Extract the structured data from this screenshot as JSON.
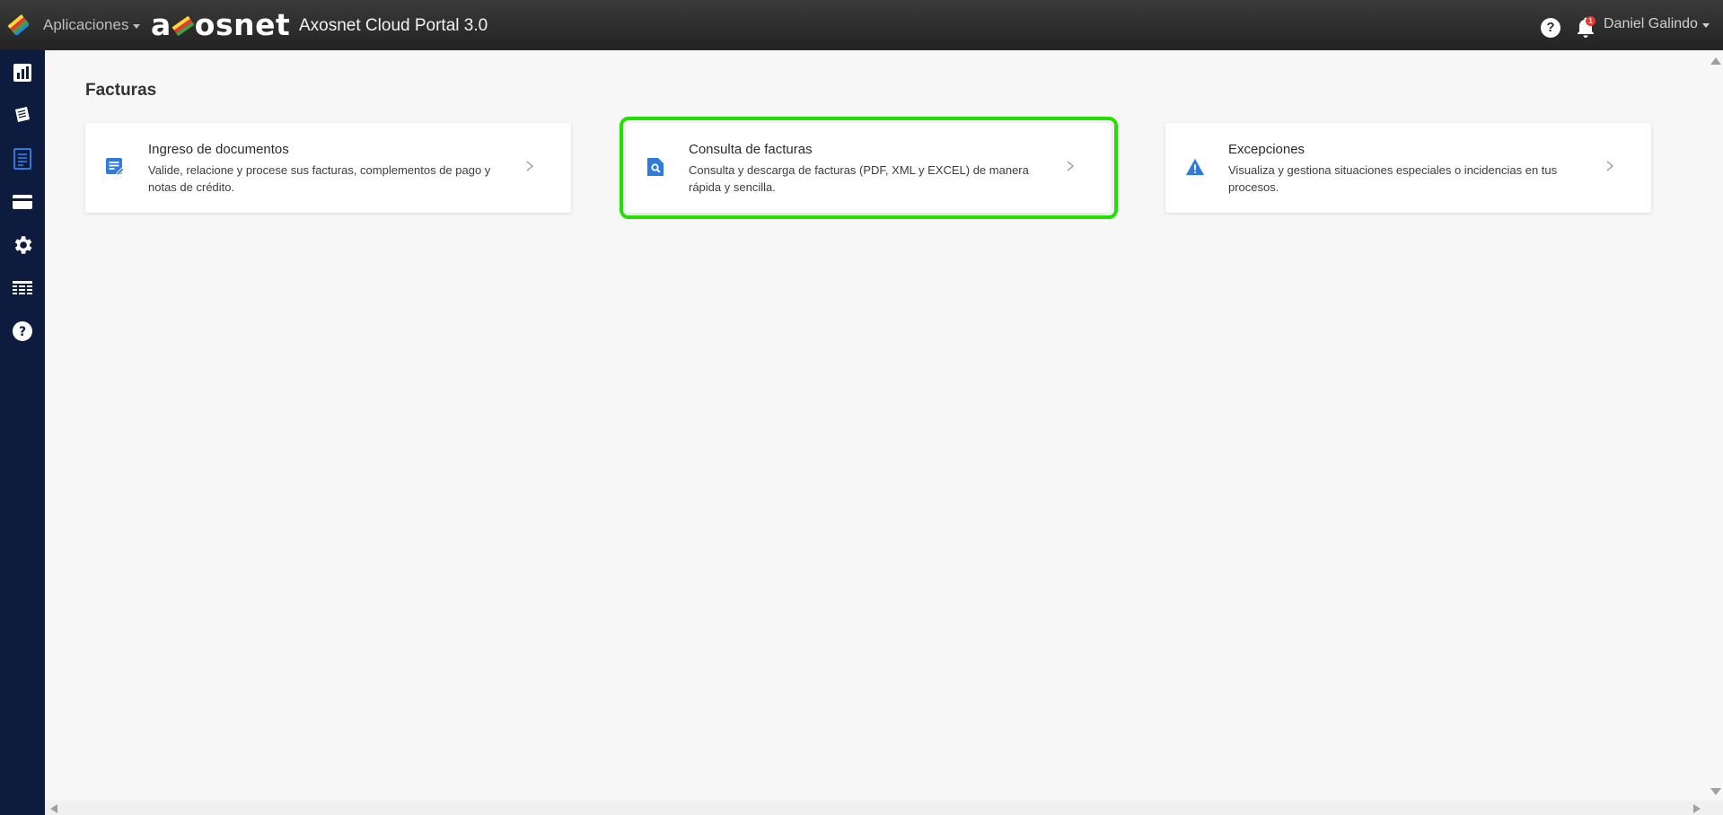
{
  "header": {
    "apps_label": "Aplicaciones",
    "brand_prefix": "a",
    "brand_suffix": "osnet",
    "portal_title": "Axosnet Cloud Portal 3.0",
    "help_label": "?",
    "notifications_count": "1",
    "user_name": "Daniel Galindo"
  },
  "sidebar": {
    "items": [
      {
        "icon": "bar-chart-icon"
      },
      {
        "icon": "documents-icon"
      },
      {
        "icon": "invoice-list-icon"
      },
      {
        "icon": "credit-card-icon"
      },
      {
        "icon": "gear-icon"
      },
      {
        "icon": "table-icon"
      },
      {
        "icon": "help-circle-icon"
      }
    ],
    "active_index": 2
  },
  "main": {
    "page_title": "Facturas",
    "cards": [
      {
        "title": "Ingreso de documentos",
        "description": "Valide, relacione y procese sus facturas, complementos de pago y notas de crédito.",
        "icon": "document-edit-icon"
      },
      {
        "title": "Consulta de facturas",
        "description": "Consulta y descarga de facturas (PDF, XML y EXCEL) de manera rápida y sencilla.",
        "icon": "file-search-icon",
        "highlighted": true
      },
      {
        "title": "Excepciones",
        "description": "Visualiza y gestiona situaciones especiales o incidencias en tus procesos.",
        "icon": "warning-icon"
      }
    ]
  },
  "colors": {
    "sidebar_bg": "#0d1b3e",
    "accent_blue": "#2f7bdc",
    "highlight_green": "#22e000",
    "topbar_bg": "#2c2c2c"
  }
}
